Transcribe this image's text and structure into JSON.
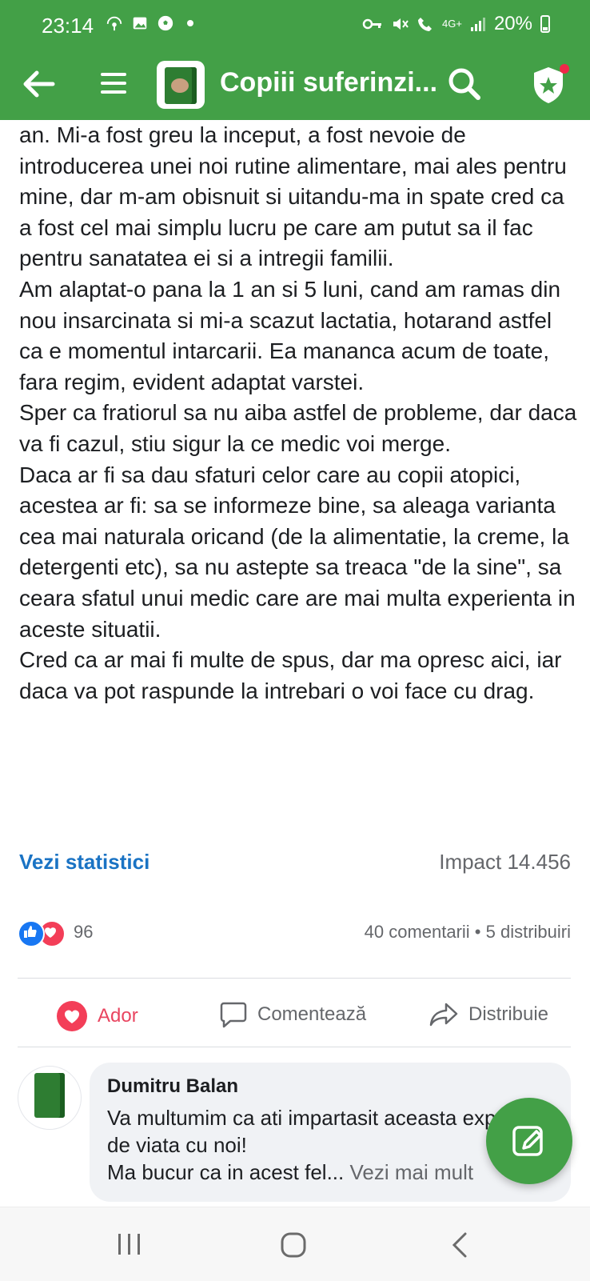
{
  "status_bar": {
    "time": "23:14",
    "network": "4G+",
    "battery": "20%"
  },
  "app_bar": {
    "title": "Copiii suferinzi...",
    "icons": [
      "back-arrow-icon",
      "hamburger-menu-icon",
      "search-icon",
      "shield-star-icon"
    ]
  },
  "post": {
    "paragraphs": [
      "an. Mi-a fost greu la inceput, a fost nevoie de introducerea unei noi rutine alimentare, mai ales pentru mine, dar m-am obisnuit si uitandu-ma in spate cred ca a fost cel mai simplu lucru pe care am putut sa il fac pentru sanatatea ei si a intregii familii.",
      "Am alaptat-o pana la 1 an si 5 luni, cand am ramas din nou insarcinata si mi-a scazut lactatia, hotarand astfel ca e momentul intarcarii. Ea mananca acum de toate, fara regim, evident adaptat varstei.",
      "Sper ca fratiorul sa nu aiba astfel de probleme, dar daca va fi cazul, stiu sigur la ce medic voi merge.",
      "Daca ar fi sa dau sfaturi celor care au copii atopici, acestea ar fi: sa se informeze bine, sa aleaga varianta cea mai naturala oricand (de la alimentatie, la creme, la detergenti etc), sa nu astepte sa treaca \"de la sine\", sa ceara sfatul unui medic care are mai multa experienta in aceste situatii.",
      "Cred ca ar mai fi multe de spus, dar ma opresc aici, iar daca va pot raspunde la intrebari o voi face cu drag."
    ],
    "stats_link": "Vezi statistici",
    "impact": "Impact 14.456",
    "reactions_count": "96",
    "comments_shares": "40 comentarii • 5 distribuiri"
  },
  "actions": {
    "react": "Ador",
    "comment": "Comentează",
    "share": "Distribuie"
  },
  "comment": {
    "author": "Dumitru Balan",
    "text": "Va multumim ca ati impartasit aceasta experienta de viata cu noi!\nMa bucur ca in acest fel...",
    "see_more": "Vezi mai mult"
  },
  "colors": {
    "header_green": "#43a047",
    "link_blue": "#1a73c4",
    "love_red": "#e94560"
  }
}
